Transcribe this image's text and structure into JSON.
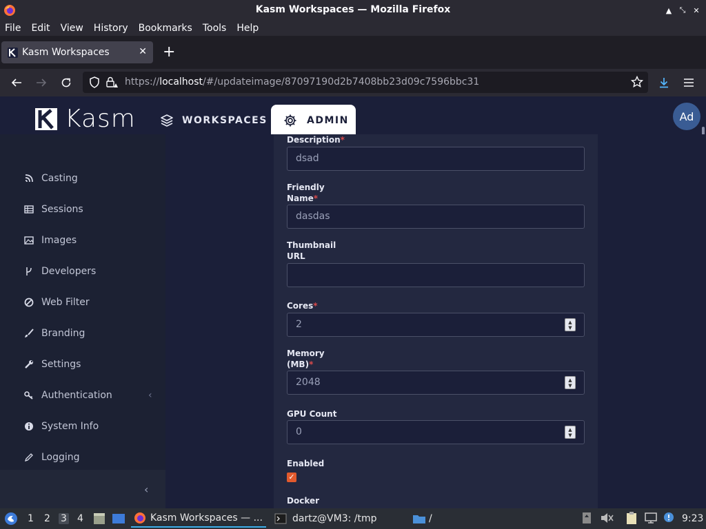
{
  "window": {
    "title": "Kasm Workspaces — Mozilla Firefox",
    "controls": [
      "▲",
      "⤡",
      "✕"
    ]
  },
  "menubar": {
    "items": [
      "File",
      "Edit",
      "View",
      "History",
      "Bookmarks",
      "Tools",
      "Help"
    ]
  },
  "tab": {
    "title": "Kasm Workspaces",
    "close": "✕",
    "new_tab": "+"
  },
  "address": {
    "prefix": "https://",
    "host": "localhost",
    "path": "/#/updateimage/87097190d2b7408bb23d09c7596bbc31"
  },
  "header": {
    "logo_text": "Kasm",
    "nav_workspaces": "WORKSPACES",
    "nav_admin": "ADMIN",
    "avatar": "Ad"
  },
  "sidebar": {
    "items": [
      {
        "label": "Casting",
        "icon": "casting-icon"
      },
      {
        "label": "Sessions",
        "icon": "table-icon"
      },
      {
        "label": "Images",
        "icon": "image-icon"
      },
      {
        "label": "Developers",
        "icon": "branch-icon"
      },
      {
        "label": "Web Filter",
        "icon": "ban-icon"
      },
      {
        "label": "Branding",
        "icon": "brush-icon"
      },
      {
        "label": "Settings",
        "icon": "wrench-icon"
      },
      {
        "label": "Authentication",
        "icon": "key-icon"
      },
      {
        "label": "System Info",
        "icon": "info-icon"
      },
      {
        "label": "Logging",
        "icon": "pencil-icon"
      }
    ],
    "auth_chevron": "‹",
    "collapse": "‹"
  },
  "form": {
    "description": {
      "label": "Description",
      "value": "dsad"
    },
    "friendly_name": {
      "label1": "Friendly",
      "label2": "Name",
      "value": "dasdas"
    },
    "thumbnail_url": {
      "label1": "Thumbnail",
      "label2": "URL",
      "value": ""
    },
    "cores": {
      "label": "Cores",
      "value": "2"
    },
    "memory": {
      "label1": "Memory",
      "label2": "(MB)",
      "value": "2048"
    },
    "gpu_count": {
      "label": "GPU Count",
      "value": "0"
    },
    "enabled": {
      "label": "Enabled",
      "checked": true
    },
    "docker": {
      "label": "Docker"
    },
    "required_mark": "*"
  },
  "taskbar": {
    "workspaces": [
      "1",
      "2",
      "3",
      "4"
    ],
    "active_workspace": "3",
    "tasks": [
      {
        "label": "Kasm Workspaces — ...",
        "icon": "firefox-icon"
      },
      {
        "label": "dartz@VM3: /tmp",
        "icon": "terminal-icon"
      },
      {
        "label": "/",
        "icon": "folder-icon"
      }
    ],
    "clock": "9:23"
  },
  "colors": {
    "accent": "#e25a2d",
    "header_bg": "#1b1f39",
    "sidebar_bg": "#1c2133",
    "card_bg": "#232840",
    "required": "#d94a4a"
  }
}
